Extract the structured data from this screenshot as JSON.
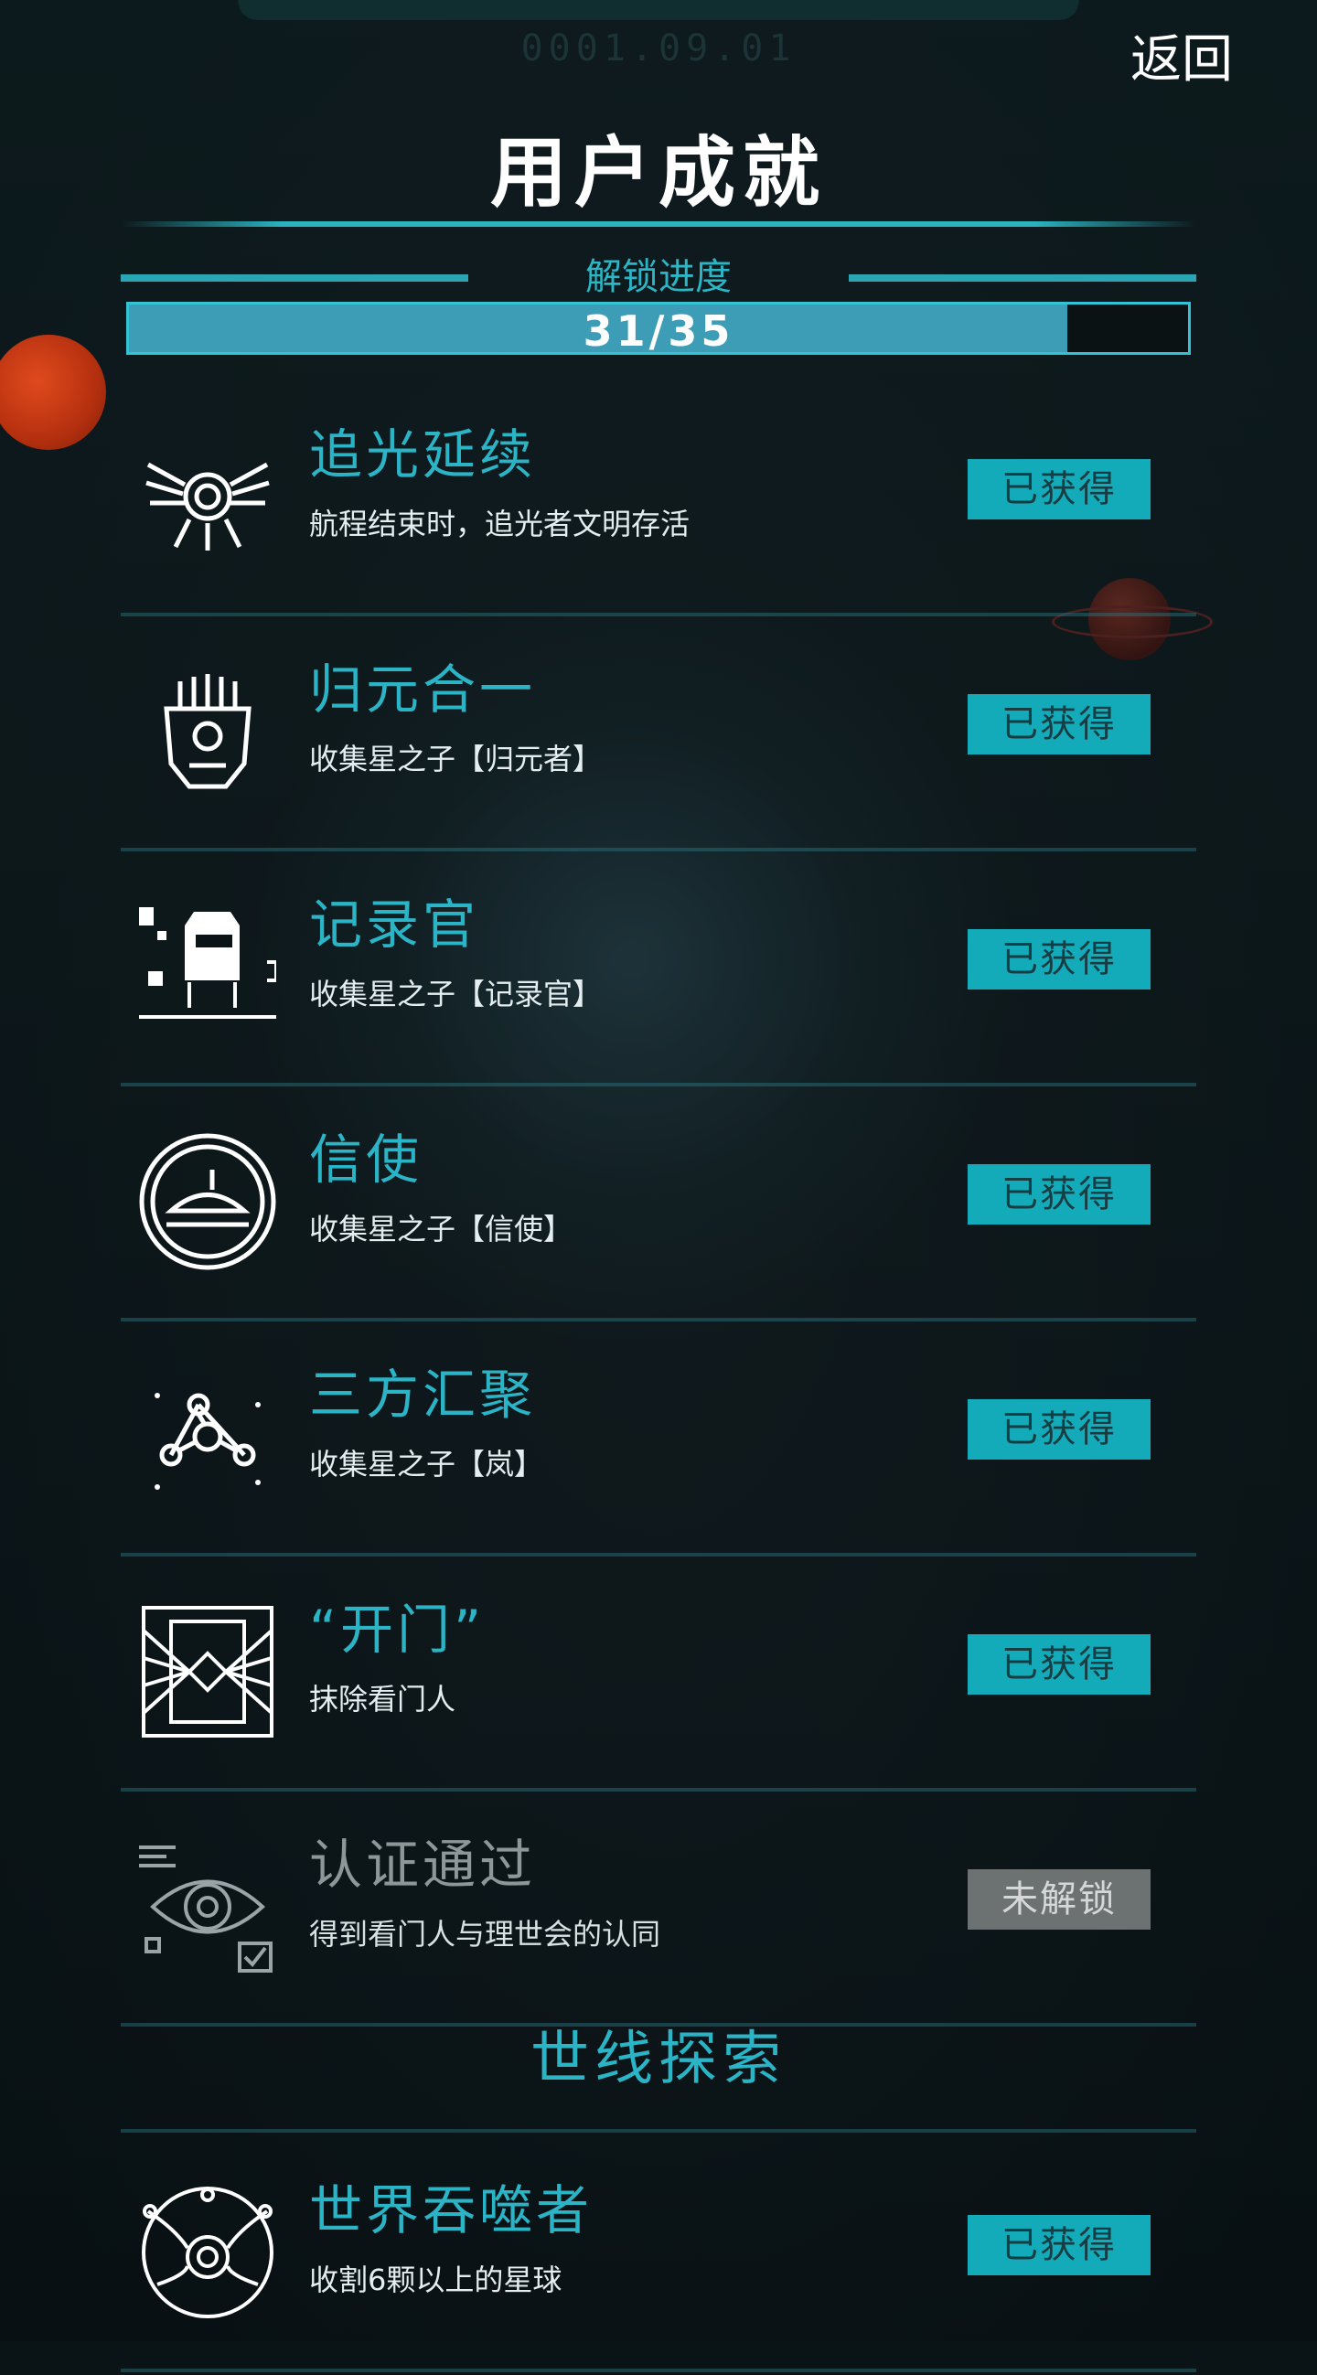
{
  "header": {
    "date": "0001.09.01",
    "back_label": "返回",
    "title": "用户成就"
  },
  "progress": {
    "label": "解锁进度",
    "text": "31/35",
    "unlocked": 31,
    "total": 35
  },
  "achievements": [
    {
      "name": "追光延续",
      "desc": "航程结束时，追光者文明存活",
      "status": "已获得",
      "icon": "winged-ring-icon"
    },
    {
      "name": "归元合一",
      "desc": "收集星之子【归元者】",
      "status": "已获得",
      "icon": "mask-icon"
    },
    {
      "name": "记录官",
      "desc": "收集星之子【记录官】",
      "status": "已获得",
      "icon": "robot-icon"
    },
    {
      "name": "信使",
      "desc": "收集星之子【信使】",
      "status": "已获得",
      "icon": "messenger-ship-icon"
    },
    {
      "name": "三方汇聚",
      "desc": "收集星之子【岚】",
      "status": "已获得",
      "icon": "network-nodes-icon"
    },
    {
      "name": "“开门”",
      "desc": "抹除看门人",
      "status": "已获得",
      "icon": "gate-icon"
    },
    {
      "name": "认证通过",
      "desc": "得到看门人与理世会的认同",
      "status": "未解锁",
      "icon": "eye-check-icon"
    }
  ],
  "section": {
    "title": "世线探索"
  },
  "section_achievements": [
    {
      "name": "世界吞噬者",
      "desc": "收割6颗以上的星球",
      "status": "已获得",
      "icon": "world-devourer-icon"
    }
  ],
  "colors": {
    "accent": "#2ab4c6",
    "acquired_badge": "#13aab9",
    "locked_badge": "#6c7172",
    "background": "#0a1316"
  }
}
